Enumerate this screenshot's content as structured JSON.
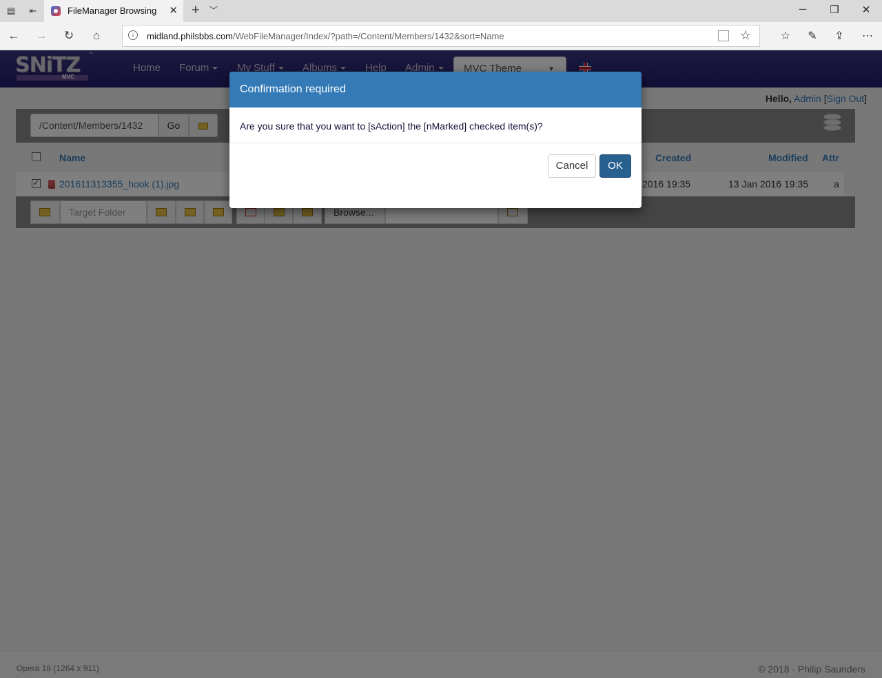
{
  "browser": {
    "tab_title": "FileManager Browsing",
    "url_host": "midland.philsbbs.com",
    "url_path": "/WebFileManager/Index/?path=/Content/Members/1432&sort=Name"
  },
  "site": {
    "logo_text": "SNiTZ",
    "logo_sub": "MVC",
    "logo_tm": "™",
    "menu": [
      "Home",
      "Forum",
      "My Stuff",
      "Albums",
      "Help",
      "Admin"
    ],
    "theme_selected": "MVC Theme"
  },
  "user": {
    "hello": "Hello,",
    "name": "Admin",
    "sign_out": "Sign Out"
  },
  "file_manager": {
    "path_value": "/Content/Members/1432",
    "go_label": "Go",
    "columns": {
      "name": "Name",
      "created": "Created",
      "modified": "Modified",
      "attr": "Attr"
    },
    "rows": [
      {
        "checked": true,
        "name": "201611313355_hook (1).jpg",
        "created_partial": "2016 19:35",
        "modified": "13 Jan 2016 19:35",
        "attr": "a"
      }
    ],
    "target_folder_placeholder": "Target Folder",
    "browse_label": "Browse..."
  },
  "footer": {
    "left": "Opera 18 (1264 x 911)",
    "right": "© 2018 - Philip Saunders"
  },
  "modal": {
    "title": "Confirmation required",
    "message": "Are you sure that you want to [sAction] the [nMarked] checked item(s)?",
    "cancel_label": "Cancel",
    "ok_label": "OK"
  },
  "colors": {
    "header_bg": "#2c2575",
    "modal_header": "#337ab7",
    "ok_button": "#286090",
    "toolbar": "#888888"
  }
}
